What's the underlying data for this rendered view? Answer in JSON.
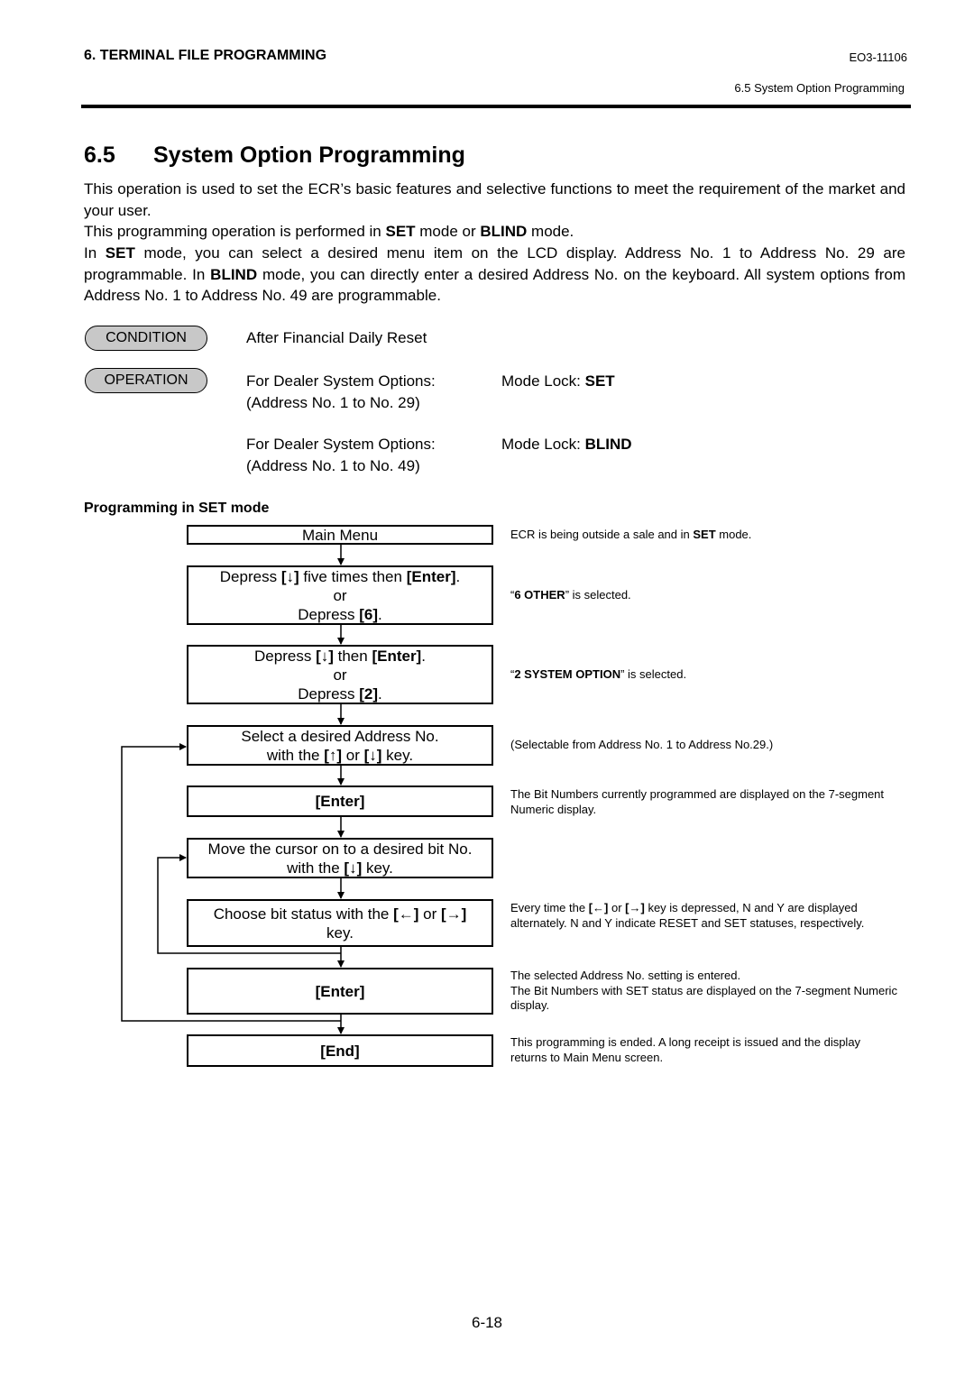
{
  "header": {
    "chapter": "6. TERMINAL FILE PROGRAMMING",
    "doc_code": "EO3-11106",
    "section_ref": "6.5 System Option Programming"
  },
  "section": {
    "number": "6.5",
    "title": "System Option Programming"
  },
  "intro": {
    "p1": "This operation is used to set the ECR’s basic features and selective functions to meet the requirement of the market and your user.",
    "p2_a": "This programming operation is performed in ",
    "p2_set": "SET",
    "p2_b": " mode or ",
    "p2_blind": "BLIND",
    "p2_c": " mode.",
    "p3_a": "In ",
    "p3_set": "SET",
    "p3_b": " mode, you can select a desired menu item on the LCD display.  Address No. 1 to Address No. 29 are programmable.  In ",
    "p3_blind": "BLIND",
    "p3_c": " mode, you can directly enter a desired Address No. on the keyboard.  All system options from Address No. 1 to Address No. 49 are programmable."
  },
  "condition": {
    "badge": "CONDITION",
    "text": "After Financial Daily Reset"
  },
  "operation": {
    "badge": "OPERATION",
    "rows": [
      {
        "line1": "For Dealer System Options:",
        "line2": "(Address No. 1 to No. 29)",
        "mode_label": "Mode Lock: ",
        "mode_value": "SET"
      },
      {
        "line1": "For Dealer System Options:",
        "line2": "(Address No. 1 to No. 49)",
        "mode_label": "Mode Lock: ",
        "mode_value": "BLIND"
      }
    ]
  },
  "set_mode": {
    "heading": "Programming in SET mode",
    "steps": [
      {
        "box": {
          "text": "Main Menu"
        },
        "note": {
          "a": "ECR is being outside a sale and in ",
          "b": "SET",
          "c": " mode."
        }
      },
      {
        "box": {
          "a": "Depress ",
          "k1": "[↓]",
          "b": " five times then ",
          "k2": "[Enter]",
          "c": ".",
          "or": "or",
          "d": "Depress ",
          "k3": "[6]",
          "e": "."
        },
        "note": {
          "a": "“",
          "b": "6 OTHER",
          "c": "” is selected."
        }
      },
      {
        "box": {
          "a": "Depress ",
          "k1": "[↓]",
          "b": " then ",
          "k2": "[Enter]",
          "c": ".",
          "or": "or",
          "d": "Depress ",
          "k3": "[2]",
          "e": "."
        },
        "note": {
          "a": "“",
          "b": "2 SYSTEM OPTION",
          "c": "” is selected."
        }
      },
      {
        "box": {
          "line1": "Select a desired Address No.",
          "a": "with the ",
          "k1": "[↑]",
          "b": " or ",
          "k2": "[↓]",
          "c": " key."
        },
        "note": {
          "text": "(Selectable from Address No. 1 to Address No.29.)"
        }
      },
      {
        "box": {
          "key": "[Enter]"
        },
        "note": {
          "text": "The Bit Numbers currently programmed are displayed on the 7-segment Numeric display."
        }
      },
      {
        "box": {
          "line1": "Move the cursor on to a desired bit No.",
          "a": "with the ",
          "k1": "[↓]",
          "b": " key."
        },
        "note": {
          "text": ""
        }
      },
      {
        "box": {
          "a": "Choose bit status with the ",
          "k1": "[←]",
          "b": " or ",
          "k2": "[→]",
          "line2": "key."
        },
        "note": {
          "a": "Every time the ",
          "k1": "[←]",
          "b": " or ",
          "k2": "[→]",
          "c": " key is depressed, N and Y are displayed alternately.  N and Y indicate RESET and SET statuses, respectively."
        }
      },
      {
        "box": {
          "key": "[Enter]"
        },
        "note": {
          "line1": "The selected Address No. setting is entered.",
          "line2": "The Bit Numbers with SET status are displayed on the 7-segment Numeric display."
        }
      },
      {
        "box": {
          "key": "[End]"
        },
        "note": {
          "text": "This programming is ended.  A long receipt is issued and the display returns to Main Menu screen."
        }
      }
    ]
  },
  "footer": {
    "page_number": "6-18"
  }
}
